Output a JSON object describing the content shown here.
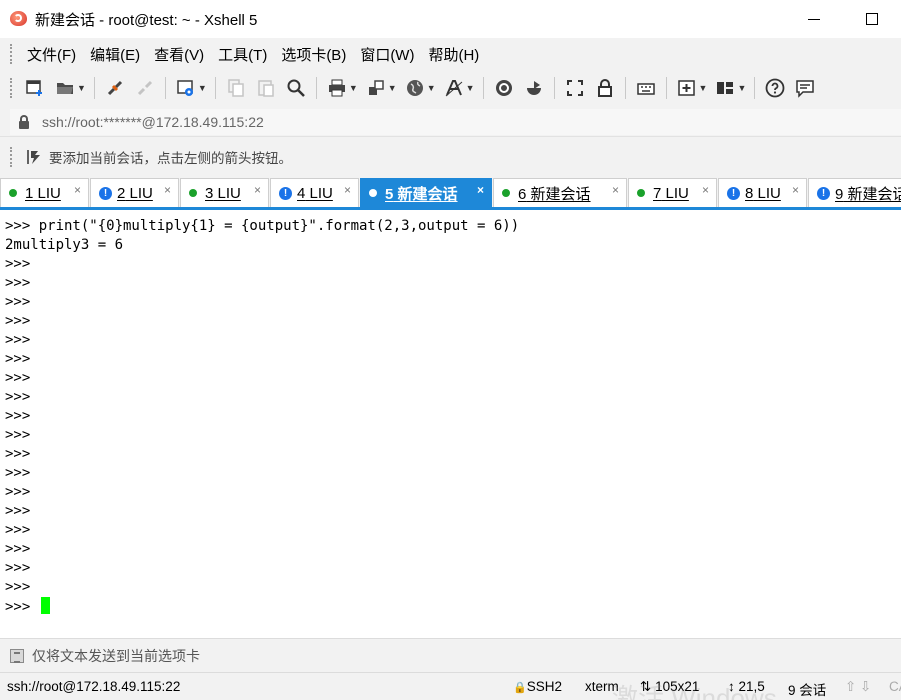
{
  "window": {
    "title": "新建会话 - root@test: ~ - Xshell 5",
    "minimize": "—",
    "maximize": "□"
  },
  "menu": [
    {
      "label": "文件(F)",
      "name": "menu-file"
    },
    {
      "label": "编辑(E)",
      "name": "menu-edit"
    },
    {
      "label": "查看(V)",
      "name": "menu-view"
    },
    {
      "label": "工具(T)",
      "name": "menu-tools"
    },
    {
      "label": "选项卡(B)",
      "name": "menu-tabs"
    },
    {
      "label": "窗口(W)",
      "name": "menu-window"
    },
    {
      "label": "帮助(H)",
      "name": "menu-help"
    }
  ],
  "address": {
    "url": "ssh://root:*******@172.18.49.115:22"
  },
  "hint": {
    "text": "要添加当前会话，点击左侧的箭头按钮。"
  },
  "tabs": [
    {
      "number": "1",
      "label": "LIU",
      "status": "connected",
      "active": false
    },
    {
      "number": "2",
      "label": "LIU",
      "status": "warning",
      "active": false
    },
    {
      "number": "3",
      "label": "LIU",
      "status": "connected",
      "active": false
    },
    {
      "number": "4",
      "label": "LIU",
      "status": "warning",
      "active": false
    },
    {
      "number": "5",
      "label": "新建会话",
      "status": "connected",
      "active": true
    },
    {
      "number": "6",
      "label": "新建会话",
      "status": "connected",
      "active": false
    },
    {
      "number": "7",
      "label": "LIU",
      "status": "connected",
      "active": false
    },
    {
      "number": "8",
      "label": "LIU",
      "status": "warning",
      "active": false
    },
    {
      "number": "9",
      "label": "新建会话",
      "status": "warning",
      "active": false
    }
  ],
  "terminal": {
    "lines": [
      ">>> print(\"{0}multiply{1} = {output}\".format(2,3,output = 6))",
      "2multiply3 = 6",
      ">>>",
      ">>>",
      ">>>",
      ">>>",
      ">>>",
      ">>>",
      ">>>",
      ">>>",
      ">>>",
      ">>>",
      ">>>",
      ">>>",
      ">>>",
      ">>>",
      ">>>",
      ">>>",
      ">>>",
      ">>>",
      ">>> "
    ],
    "cursor_color": "#00ff00"
  },
  "compose": {
    "text": "仅将文本发送到当前选项卡"
  },
  "status": {
    "connection": "ssh://root@172.18.49.115:22",
    "protocol": "SSH2",
    "terminal_type": "xterm",
    "size": "105x21",
    "cursor_pos": "21,5",
    "sessions": "9 会话",
    "caps": "CAP",
    "watermark": "激活 Windows"
  },
  "colors": {
    "accent": "#1e88d8",
    "connected": "#1aa12b",
    "warning": "#1a73e8"
  }
}
